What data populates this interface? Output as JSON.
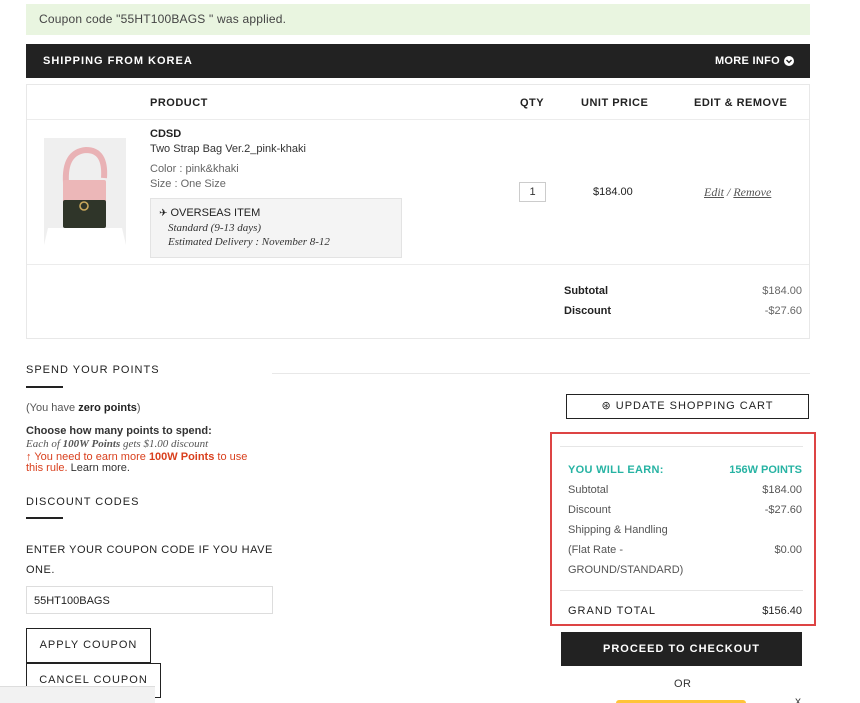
{
  "notice": {
    "text": "Coupon code \"55HT100BAGS \" was applied."
  },
  "shipping": {
    "title": "SHIPPING FROM KOREA",
    "more_info": "MORE INFO"
  },
  "table_headers": {
    "product": "PRODUCT",
    "qty": "QTY",
    "unit_price": "UNIT PRICE",
    "edit_remove": "EDIT & REMOVE"
  },
  "item": {
    "brand": "CDSD",
    "name": "Two Strap Bag Ver.2_pink-khaki",
    "color": "Color : pink&khaki",
    "size": "Size : One Size",
    "overseas_label": "OVERSEAS ITEM",
    "standard": "Standard (9-13 days)",
    "delivery": "Estimated Delivery : November 8-12",
    "qty": "1",
    "unit_price": "$184.00",
    "edit": "Edit",
    "separator": "/",
    "remove": "Remove"
  },
  "totals": {
    "subtotal_label": "Subtotal",
    "subtotal": "$184.00",
    "discount_label": "Discount",
    "discount": "-$27.60"
  },
  "points": {
    "title": "SPEND YOUR POINTS",
    "have_prefix": "(You have ",
    "have_bold": "zero points",
    "have_suffix": ")",
    "how": "Choose how many points to spend:",
    "each_a": "Each of ",
    "each_b": "100W Points",
    "each_c": " gets $1.00 discount",
    "warn_a": "You need to earn more ",
    "warn_b": "100W Points",
    "warn_c": " to use this rule.",
    "learn_more": " Learn more."
  },
  "discount": {
    "title": "DISCOUNT CODES",
    "enter_label": "ENTER YOUR COUPON CODE IF YOU HAVE ONE.",
    "code": "55HT100BAGS",
    "apply": "APPLY COUPON",
    "cancel": "CANCEL COUPON"
  },
  "cart": {
    "update": "UPDATE SHOPPING CART",
    "earn_label": "YOU WILL EARN:",
    "earn_value": "156W POINTS",
    "subtotal_label": "Subtotal",
    "subtotal": "$184.00",
    "discount_label": "Discount",
    "discount": "-$27.60",
    "shipping_label": "Shipping & Handling",
    "flat_rate_label": "(Flat Rate -",
    "flat_rate_value": "$0.00",
    "ground_label": "GROUND/STANDARD)",
    "grand_label": "GRAND TOTAL",
    "grand_value": "$156.40",
    "checkout": "PROCEED TO CHECKOUT",
    "or": "OR",
    "close": "x"
  },
  "colors": {
    "accent_teal": "#27b3a3",
    "warning_red": "#d9401e",
    "highlight_border": "#dd4444",
    "dark": "#222222",
    "notice_bg": "#e9f5e0"
  }
}
